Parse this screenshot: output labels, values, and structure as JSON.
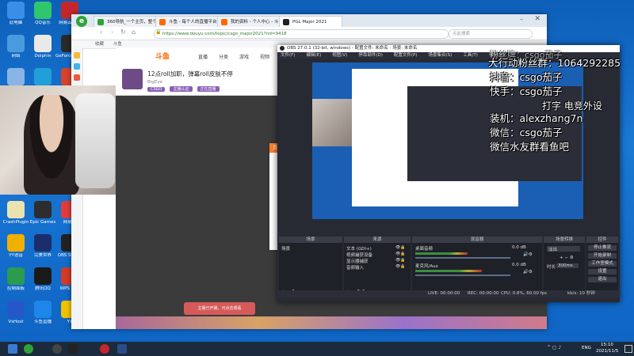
{
  "desktop_icons": [
    {
      "label": "此电脑",
      "color": "#3a8ee6"
    },
    {
      "label": "QQ音乐",
      "color": "#2fc76d"
    },
    {
      "label": "网易云音乐",
      "color": "#c3272b"
    },
    {
      "label": "网络",
      "color": "#4a9ae0"
    },
    {
      "label": "Dolphin",
      "color": "#e9e9e9"
    },
    {
      "label": "GeForce Experience",
      "color": "#2a2a2a"
    },
    {
      "label": "回收站",
      "color": "#89b4e6"
    },
    {
      "label": "Microsoft Edge",
      "color": "#1fa0d8"
    },
    {
      "label": "WPS Office",
      "color": "#d8432c"
    },
    {
      "label": "CrashPlugin",
      "color": "#eae3b0"
    },
    {
      "label": "Epic Games",
      "color": "#2d2d2d"
    },
    {
      "label": "网易云",
      "color": "#e03c3c"
    },
    {
      "label": "YY语音",
      "color": "#f0b000"
    },
    {
      "label": "完美世界",
      "color": "#1c2d6b"
    },
    {
      "label": "OBS Studio",
      "color": "#222222"
    },
    {
      "label": "控制面板",
      "color": "#2a9b4f"
    },
    {
      "label": "腾讯QQ",
      "color": "#1a1a1a"
    },
    {
      "label": "WPS PDF",
      "color": "#d23a2a"
    },
    {
      "label": "VsHost",
      "color": "#2458c9"
    },
    {
      "label": "斗鱼直播",
      "color": "#1e86e8"
    },
    {
      "label": "YY",
      "color": "#f2c200"
    }
  ],
  "browser": {
    "tabs": [
      {
        "label": "360导航_一个主页，整个世界",
        "color": "#2fa33a"
      },
      {
        "label": "斗鱼 - 每个人的直播平台",
        "color": "#ff6a00"
      },
      {
        "label": "我的资料 - 个人中心 - 斗鱼",
        "color": "#ff6a00"
      },
      {
        "label": "PGL Major 2021",
        "color": "#222222"
      }
    ],
    "url": "https://www.douyu.com/topic/csgo_major2021?rid=9418",
    "search_placeholder": "点此搜索",
    "bookmark_label": "收藏",
    "bookmark_item": "斗鱼"
  },
  "page": {
    "logo": "斗鱼",
    "nav": [
      "直播",
      "分类",
      "游戏",
      "视频",
      "鱼吧"
    ],
    "room_title": "12点roll加职，弹幕roll皮肤不停",
    "streamer": "BigEye",
    "tag_labels": [
      "CSGO",
      "主播认证",
      "正在直播"
    ],
    "popup_title": "直播信息",
    "popup_line1": "rtmp地址",
    "popup_line2": "直播码",
    "popup_note": [
      "注：",
      "1、",
      "2、",
      "推流"
    ],
    "bottom_notice": "主播已开播，可点击观看"
  },
  "obs": {
    "title": "OBS 27.0.1 (32-bit, windows) - 配置文件: 未命名 - 场景: 未命名",
    "menu": [
      "文件(F)",
      "编辑(E)",
      "视图(V)",
      "停靠部件(D)",
      "配置文件(P)",
      "场景集合(S)",
      "工具(T)",
      "帮助(H)"
    ],
    "panels": {
      "scenes": "场景",
      "sources": "来源",
      "mixer": "混音器",
      "transitions": "场景转换",
      "controls": "控件"
    },
    "scene_item": "场景",
    "sources": [
      "文本 (GDI+)",
      "视频捕获设备",
      "显示器捕获",
      "音频输入"
    ],
    "mixer_tracks": [
      {
        "name": "桌面音频",
        "db": "0.0 dB",
        "level": 0.55
      },
      {
        "name": "麦克风/Aux",
        "db": "0.0 dB",
        "level": 0.7
      }
    ],
    "transition_type": "淡出",
    "duration_label": "时长",
    "duration_value": "300ms",
    "controls": [
      "停止推流",
      "开始录制",
      "工作室模式",
      "设置",
      "退出"
    ],
    "status": {
      "live": "LIVE: 00:00:00",
      "rec": "REC: 00:00:00",
      "cpu": "CPU: 0.8%, 60.00 fps",
      "kb": "kb/s: 10 秒钟"
    }
  },
  "overlay_lines": [
    "大行动粉丝群：1064292285",
    "抖音：csgo茄子",
    "快手：csgo茄子",
    "装机：alexzhang7n",
    "微信：csgo茄子",
    "微信水友群看鱼吧"
  ],
  "overlay_top": "粉丝牌：csgo茄子",
  "overlay_mid": "打字 电竞外设",
  "taskbar": {
    "lang": "ENG",
    "time": "15:10",
    "date": "2021/11/5"
  }
}
